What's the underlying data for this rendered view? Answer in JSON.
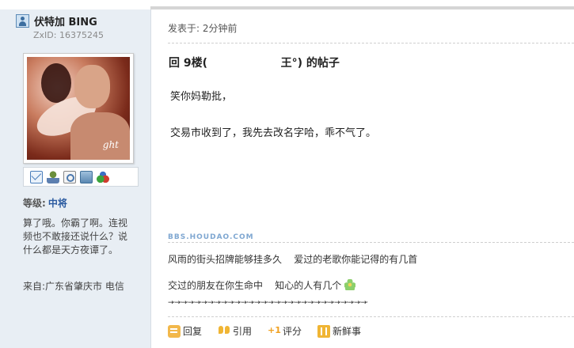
{
  "author": {
    "name": "伏特加 BING",
    "zxid": "ZxID:  16375245",
    "avatar_signature": "ght",
    "rank_label": "等级:",
    "rank_value": "中将",
    "signature": "算了哦。你霸了啊。连视频也不敢接还说什么？说什么都是天方夜谭了。",
    "location": "来自:广东省肇庆市 电信"
  },
  "post": {
    "posted_time": "发表于: 2分钟前",
    "title": "回 9楼(                   王°) 的帖子",
    "body_lines": [
      "笑你妈勒批，",
      "交易市收到了，我先去改名字哈，乖不气了。"
    ],
    "watermark": "BBS.HOUDAO.COM",
    "signature_lines": [
      "风雨的街头招牌能够挂多久    爱过的老歌你能记得的有几首",
      "交过的朋友在你生命中    知心的人有几个"
    ],
    "divider_arrows": "→·→·→·→·→·→·→·→·→·→·→·→·→·→·→·→·→·→·→·→·→·→·→·→·→·→·→·→·→·→·"
  },
  "actions": [
    {
      "label": "回复",
      "icon": "reply-icon"
    },
    {
      "label": "引用",
      "icon": "quote-icon"
    },
    {
      "label": "评分",
      "icon": "rate-icon"
    },
    {
      "label": "新鲜事",
      "icon": "news-icon"
    }
  ]
}
